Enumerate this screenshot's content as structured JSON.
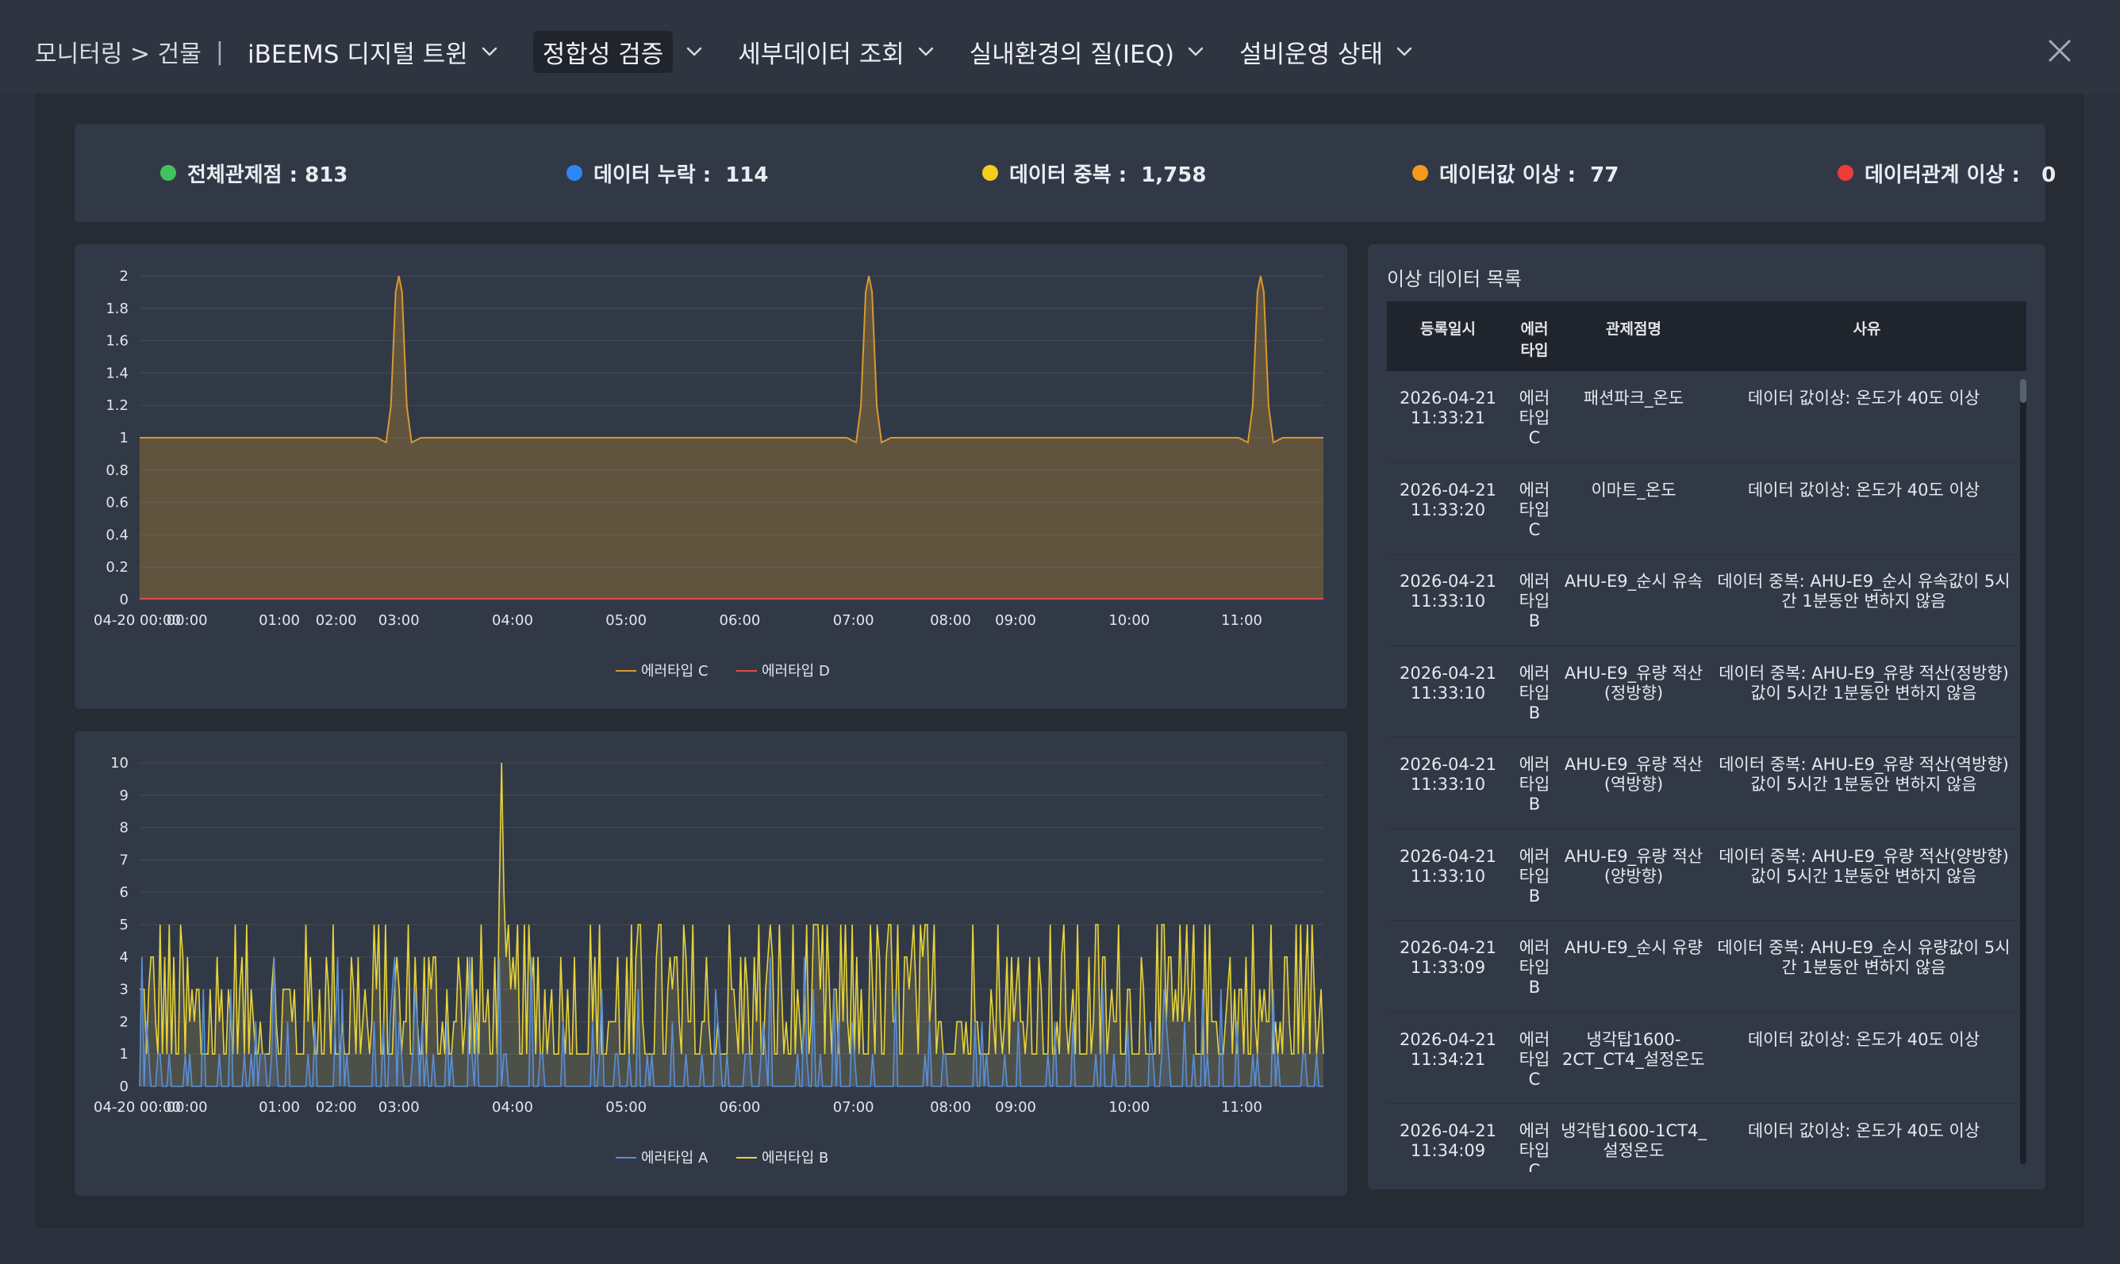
{
  "breadcrumb": {
    "section": "모니터링 > 건물",
    "separator": "|"
  },
  "nav": [
    {
      "label": "iBEEMS 디지털 트윈",
      "active": false
    },
    {
      "label": "정합성 검증",
      "active": true
    },
    {
      "label": "세부데이터 조회",
      "active": false
    },
    {
      "label": "실내환경의 질(IEQ)",
      "active": false
    },
    {
      "label": "설비운영 상태",
      "active": false
    }
  ],
  "stats": [
    {
      "label": "전체관제점 : 813",
      "color": "#3fc35a"
    },
    {
      "label": "데이터 누락 :  114",
      "color": "#2f86f6"
    },
    {
      "label": "데이터 중복 :  1,758",
      "color": "#f5cd1e"
    },
    {
      "label": "데이터값 이상 :  77",
      "color": "#f59a1c"
    },
    {
      "label": "데이터관계 이상 :   0",
      "color": "#ef3b3b"
    }
  ],
  "chart_data": [
    {
      "type": "area",
      "x_ticks": [
        "04-20 00:00",
        "00:00",
        "01:00",
        "02:00",
        "03:00",
        "04:00",
        "05:00",
        "06:00",
        "07:00",
        "08:00",
        "09:00",
        "10:00",
        "11:00"
      ],
      "ylim": [
        0,
        2
      ],
      "y_ticks": [
        "0",
        "0.2",
        "0.4",
        "0.6",
        "0.8",
        "1",
        "1.2",
        "1.4",
        "1.6",
        "1.8",
        "2"
      ],
      "grid": true,
      "legend": "bottom",
      "series": [
        {
          "name": "에러타입 C",
          "color": "#d8992e",
          "baseline": 1,
          "spikes": [
            {
              "at": 0.219,
              "value": 2
            },
            {
              "at": 0.616,
              "value": 2
            },
            {
              "at": 0.947,
              "value": 2
            }
          ]
        },
        {
          "name": "에러타입 D",
          "color": "#e0494b",
          "baseline": 0
        }
      ]
    },
    {
      "type": "area",
      "x_ticks": [
        "04-20 00:00",
        "00:00",
        "01:00",
        "02:00",
        "03:00",
        "04:00",
        "05:00",
        "06:00",
        "07:00",
        "08:00",
        "09:00",
        "10:00",
        "11:00"
      ],
      "ylim": [
        0,
        10
      ],
      "y_ticks": [
        "0",
        "1",
        "2",
        "3",
        "4",
        "5",
        "6",
        "7",
        "8",
        "9",
        "10"
      ],
      "grid": true,
      "legend": "bottom",
      "series": [
        {
          "name": "에러타입 A",
          "color": "#5b8fd6",
          "range": [
            0,
            5
          ]
        },
        {
          "name": "에러타입 B",
          "color": "#e7d43a",
          "range": [
            1,
            5
          ],
          "peak": 10
        }
      ]
    }
  ],
  "list": {
    "title": "이상 데이터 목록",
    "headers": [
      "등록일시",
      "에러\n타입",
      "관제점명",
      "사유"
    ],
    "rows": [
      {
        "date": "2026-04-21\n11:33:21",
        "type": "에러\n타입\nC",
        "point": "패션파크_온도",
        "reason": "데이터 값이상: 온도가 40도 이상"
      },
      {
        "date": "2026-04-21\n11:33:20",
        "type": "에러\n타입\nC",
        "point": "이마트_온도",
        "reason": "데이터 값이상: 온도가 40도 이상"
      },
      {
        "date": "2026-04-21\n11:33:10",
        "type": "에러\n타입\nB",
        "point": "AHU-E9_순시 유속",
        "reason": "데이터 중복: AHU-E9_순시 유속값이 5시간 1분동안 변하지 않음"
      },
      {
        "date": "2026-04-21\n11:33:10",
        "type": "에러\n타입\nB",
        "point": "AHU-E9_유량 적산(정방향)",
        "reason": "데이터 중복: AHU-E9_유량 적산(정방향)값이 5시간 1분동안 변하지 않음"
      },
      {
        "date": "2026-04-21\n11:33:10",
        "type": "에러\n타입\nB",
        "point": "AHU-E9_유량 적산(역방향)",
        "reason": "데이터 중복: AHU-E9_유량 적산(역방향)값이 5시간 1분동안 변하지 않음"
      },
      {
        "date": "2026-04-21\n11:33:10",
        "type": "에러\n타입\nB",
        "point": "AHU-E9_유량 적산(양방향)",
        "reason": "데이터 중복: AHU-E9_유량 적산(양방향)값이 5시간 1분동안 변하지 않음"
      },
      {
        "date": "2026-04-21\n11:33:09",
        "type": "에러\n타입\nB",
        "point": "AHU-E9_순시 유량",
        "reason": "데이터 중복: AHU-E9_순시 유량값이 5시간 1분동안 변하지 않음"
      },
      {
        "date": "2026-04-21\n11:34:21",
        "type": "에러\n타입\nC",
        "point": "냉각탑1600-2CT_CT4_설정온도",
        "reason": "데이터 값이상: 온도가 40도 이상"
      },
      {
        "date": "2026-04-21\n11:34:09",
        "type": "에러\n타입\nC",
        "point": "냉각탑1600-1CT4_설정온도",
        "reason": "데이터 값이상: 온도가 40도 이상"
      }
    ]
  }
}
